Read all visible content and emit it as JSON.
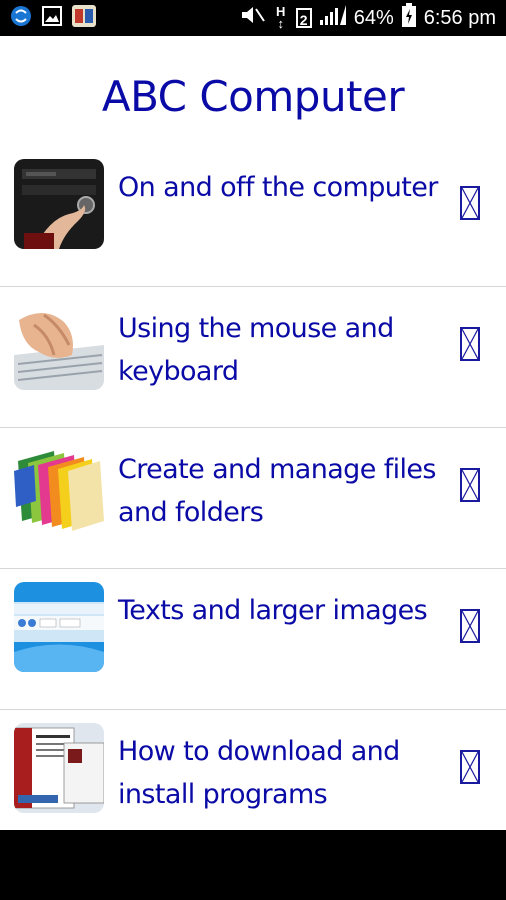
{
  "status_bar": {
    "icons_left": [
      "sync-icon",
      "gallery-icon",
      "book-app-icon"
    ],
    "icons_right": [
      "mute-icon",
      "hd-signal-icon",
      "sim-2-icon",
      "signal-bars-icon"
    ],
    "sim_label": "2",
    "hd_label": "H",
    "battery": "64%",
    "time": "6:56 pm"
  },
  "app": {
    "title": "ABC Computer",
    "accent_color": "#0a0aa6",
    "items": [
      {
        "label": "On and off the computer",
        "icon": "power-button-photo"
      },
      {
        "label": "Using the mouse and keyboard",
        "icon": "keyboard-typing-photo"
      },
      {
        "label": "Create and manage files and folders",
        "icon": "colored-folders-photo"
      },
      {
        "label": "Texts and larger images",
        "icon": "magnifier-window-photo"
      },
      {
        "label": "How to download and install programs",
        "icon": "setup-wizard-photo"
      }
    ]
  }
}
